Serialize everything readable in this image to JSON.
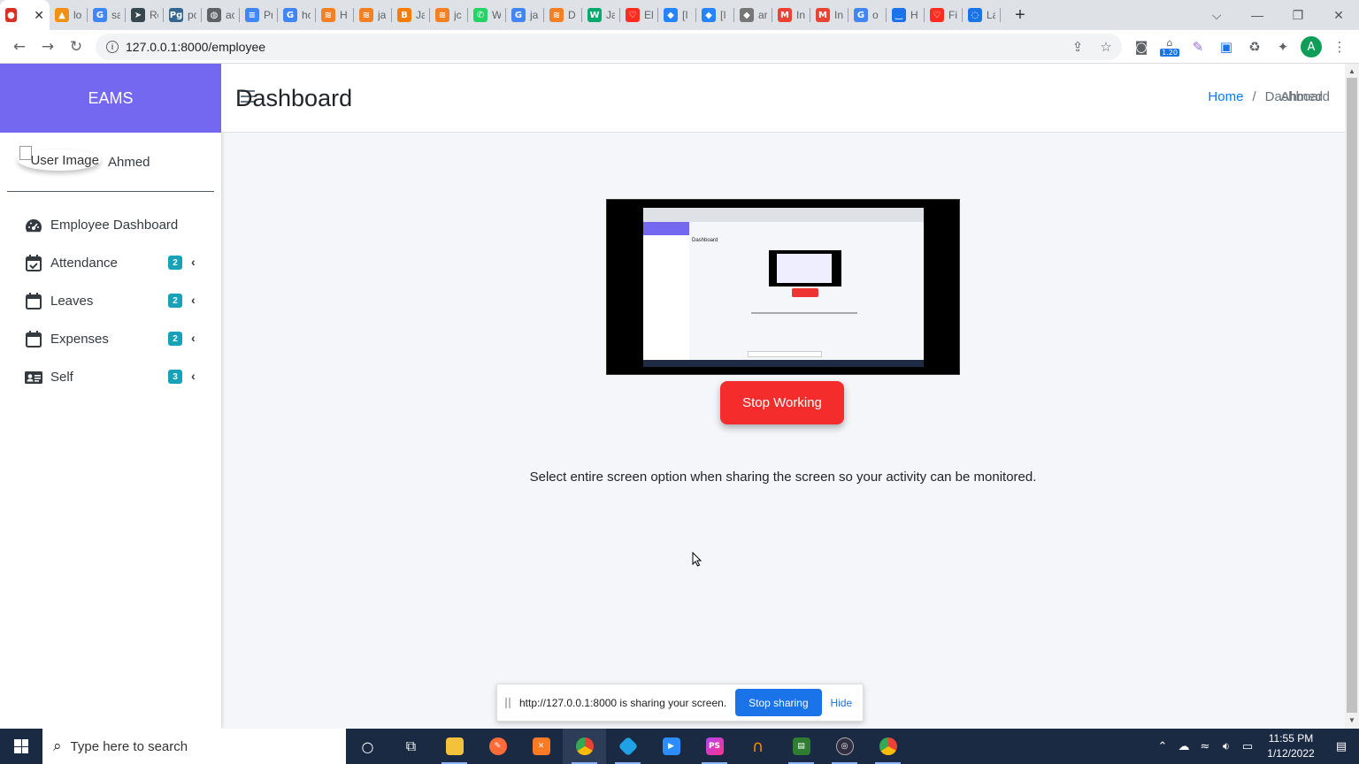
{
  "browser": {
    "tabs": [
      {
        "icon": "recording-icon",
        "color": "#d93025",
        "glyph": "●",
        "title": ""
      },
      {
        "icon": "phpmyadmin-icon",
        "color": "#f29111",
        "glyph": "▲",
        "title": "lo"
      },
      {
        "icon": "google-icon",
        "color": "#4285f4",
        "glyph": "G",
        "title": "sa"
      },
      {
        "icon": "telegram-icon",
        "color": "#37474f",
        "glyph": "➤",
        "title": "Re"
      },
      {
        "icon": "postgres-icon",
        "color": "#336791",
        "glyph": "Pg",
        "title": "pc"
      },
      {
        "icon": "globe-icon",
        "color": "#5f6368",
        "glyph": "◍",
        "title": "ac"
      },
      {
        "icon": "docs-icon",
        "color": "#4285f4",
        "glyph": "≡",
        "title": "Pr"
      },
      {
        "icon": "google-icon",
        "color": "#4285f4",
        "glyph": "G",
        "title": "hc"
      },
      {
        "icon": "stackoverflow-icon",
        "color": "#f48024",
        "glyph": "≋",
        "title": "H"
      },
      {
        "icon": "stackoverflow-icon",
        "color": "#f48024",
        "glyph": "≋",
        "title": "ja"
      },
      {
        "icon": "blogger-icon",
        "color": "#f57d00",
        "glyph": "B",
        "title": "Ja"
      },
      {
        "icon": "stackoverflow-icon",
        "color": "#f48024",
        "glyph": "≋",
        "title": "jc"
      },
      {
        "icon": "whatsapp-icon",
        "color": "#25d366",
        "glyph": "✆",
        "title": "W"
      },
      {
        "icon": "google-icon",
        "color": "#4285f4",
        "glyph": "G",
        "title": "ja"
      },
      {
        "icon": "stackoverflow-icon",
        "color": "#f48024",
        "glyph": "≋",
        "title": "D"
      },
      {
        "icon": "w3schools-icon",
        "color": "#04aa6d",
        "glyph": "W",
        "title": "Ja"
      },
      {
        "icon": "laravel-icon",
        "color": "#ff2d20",
        "glyph": "♡",
        "title": "El"
      },
      {
        "icon": "jira-icon",
        "color": "#2684ff",
        "glyph": "◆",
        "title": "[I"
      },
      {
        "icon": "jira-icon",
        "color": "#2684ff",
        "glyph": "◆",
        "title": "[I"
      },
      {
        "icon": "diamond-icon",
        "color": "#777777",
        "glyph": "◆",
        "title": "ar"
      },
      {
        "icon": "gmail-icon",
        "color": "#ea4335",
        "glyph": "M",
        "title": "In"
      },
      {
        "icon": "gmail-icon",
        "color": "#ea4335",
        "glyph": "M",
        "title": "In"
      },
      {
        "icon": "google-icon",
        "color": "#4285f4",
        "glyph": "G",
        "title": "o"
      },
      {
        "icon": "smile-icon",
        "color": "#1a73e8",
        "glyph": "‿",
        "title": "H"
      },
      {
        "icon": "laravel-icon",
        "color": "#ff2d20",
        "glyph": "♡",
        "title": "Fi"
      },
      {
        "icon": "loading-icon",
        "color": "#1a73e8",
        "glyph": "◌",
        "title": "La"
      }
    ],
    "url": "127.0.0.1:8000/employee",
    "extension_badge": "1.20",
    "profile_initial": "A"
  },
  "app": {
    "brand": "EAMS",
    "user_image_alt": "User Image",
    "user_name": "Ahmed",
    "topbar_user": "Ahmed",
    "nav": [
      {
        "label": "Employee Dashboard",
        "icon": "dashboard-gauge-icon",
        "badge": ""
      },
      {
        "label": "Attendance",
        "icon": "calendar-check-icon",
        "badge": "2"
      },
      {
        "label": "Leaves",
        "icon": "calendar-icon",
        "badge": "2"
      },
      {
        "label": "Expenses",
        "icon": "calendar-icon",
        "badge": "2"
      },
      {
        "label": "Self",
        "icon": "id-card-icon",
        "badge": "3"
      }
    ],
    "page_title": "Dashboard",
    "breadcrumb": {
      "home": "Home",
      "separator": "/",
      "current": "Dashboard"
    },
    "stop_button": "Stop Working",
    "instruction": "Select entire screen option when sharing the screen so your activity can be monitored.",
    "accent_color": "#7468f0",
    "stop_color": "#f42c2c",
    "badge_color": "#17a2b8"
  },
  "share_bar": {
    "message": "http://127.0.0.1:8000 is sharing your screen.",
    "stop_label": "Stop sharing",
    "hide_label": "Hide"
  },
  "taskbar": {
    "search_placeholder": "Type here to search",
    "time": "11:55 PM",
    "date": "1/12/2022"
  }
}
